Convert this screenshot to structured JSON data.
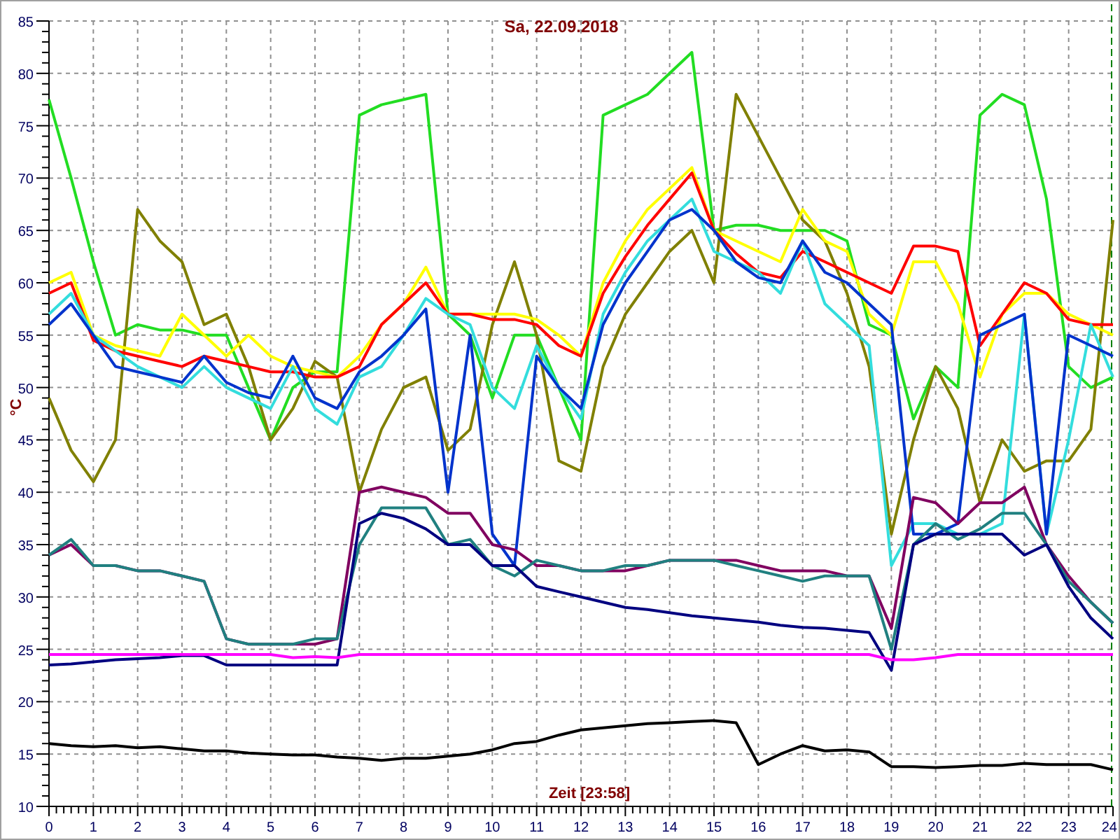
{
  "chart": {
    "chart_data": {
      "type": "line",
      "title": "Sa, 22.09.2018",
      "xlabel": "Zeit [23:58]",
      "ylabel": "°C",
      "x": [
        0,
        0.5,
        1,
        1.5,
        2,
        2.5,
        3,
        3.5,
        4,
        4.5,
        5,
        5.5,
        6,
        6.5,
        7,
        7.5,
        8,
        8.5,
        9,
        9.5,
        10,
        10.5,
        11,
        11.5,
        12,
        12.5,
        13,
        13.5,
        14,
        14.5,
        15,
        15.5,
        16,
        16.5,
        17,
        17.5,
        18,
        18.5,
        19,
        19.5,
        20,
        20.5,
        21,
        21.5,
        22,
        22.5,
        23,
        23.5,
        24
      ],
      "series": [
        {
          "color": "#22dd22",
          "values": [
            77.5,
            70,
            62,
            55,
            56,
            55.5,
            55.5,
            55,
            55,
            50,
            45,
            50,
            51.5,
            51.5,
            76,
            77,
            77.5,
            78,
            57,
            55,
            49,
            55,
            55,
            50,
            45,
            76,
            77,
            78,
            80,
            82,
            65,
            65.5,
            65.5,
            65,
            65,
            65,
            64,
            56,
            55,
            47,
            52,
            50,
            76,
            78,
            77,
            68,
            52,
            50,
            51
          ]
        },
        {
          "color": "#808000",
          "values": [
            49,
            44,
            41,
            45,
            67,
            64,
            62,
            56,
            57,
            52,
            45,
            48,
            52.5,
            51,
            40,
            46,
            50,
            51,
            44,
            46,
            56,
            62,
            55,
            43,
            42,
            52,
            57,
            60,
            63,
            65,
            60,
            78,
            74,
            70,
            66,
            64,
            59,
            52,
            36,
            45,
            52,
            48,
            39,
            45,
            42,
            43,
            43,
            46,
            66
          ]
        },
        {
          "color": "#ffff00",
          "values": [
            60,
            61,
            55,
            54,
            53.5,
            53,
            57,
            55,
            53,
            55,
            53,
            52,
            51.5,
            51,
            53,
            56,
            58,
            61.5,
            57,
            57,
            57,
            57,
            56.5,
            55,
            53,
            60,
            64,
            67,
            69,
            71,
            65,
            64,
            63,
            62,
            67,
            64,
            63,
            57,
            55,
            62,
            62,
            58,
            51,
            57,
            59,
            59,
            57,
            56,
            55
          ]
        },
        {
          "color": "#ff0000",
          "values": [
            59,
            60,
            54.5,
            53.5,
            53,
            52.5,
            52,
            53,
            52.5,
            52,
            51.5,
            51.5,
            51,
            51,
            52,
            56,
            58,
            60,
            57,
            57,
            56.5,
            56.5,
            56,
            54,
            53,
            59,
            62.5,
            65.5,
            68,
            70.5,
            65,
            62.8,
            61,
            60.5,
            63,
            62,
            61,
            60,
            59,
            63.5,
            63.5,
            63,
            54,
            57,
            60,
            59,
            56.5,
            56,
            56
          ]
        },
        {
          "color": "#33dddd",
          "values": [
            57,
            59,
            55,
            53.5,
            52,
            51,
            50,
            52,
            50,
            49,
            48,
            52,
            48,
            46.5,
            51,
            52,
            55,
            58.5,
            57,
            56,
            50,
            48,
            54,
            50,
            47,
            57,
            61,
            64,
            66,
            68,
            63,
            62,
            61,
            59,
            64,
            58,
            56,
            54,
            33,
            37,
            37,
            36,
            36,
            37,
            57,
            36,
            45,
            56,
            51
          ]
        },
        {
          "color": "#0033cc",
          "values": [
            56,
            58,
            55,
            52,
            51.5,
            51,
            50.5,
            53,
            50.5,
            49.5,
            49,
            53,
            49,
            48,
            51.5,
            53,
            55,
            57.5,
            40,
            55,
            36,
            33,
            53,
            50,
            48,
            56,
            60,
            63,
            66,
            67,
            65,
            62,
            60.5,
            60,
            64,
            61,
            60,
            58,
            56,
            36,
            36,
            37,
            55,
            56,
            57,
            36,
            55,
            54,
            53
          ]
        },
        {
          "color": "#800060",
          "values": [
            34,
            35,
            33,
            33,
            32.5,
            32.5,
            32,
            31.5,
            26,
            25.5,
            25.5,
            25.5,
            25.5,
            26,
            40,
            40.5,
            40,
            39.5,
            38,
            38,
            35,
            34.5,
            33,
            33,
            32.5,
            32.5,
            32.5,
            33,
            33.5,
            33.5,
            33.5,
            33.5,
            33,
            32.5,
            32.5,
            32.5,
            32,
            32,
            27,
            39.5,
            39,
            37,
            39,
            39,
            40.5,
            35,
            32,
            29.5,
            27.5
          ]
        },
        {
          "color": "#208080",
          "values": [
            34,
            35.5,
            33,
            33,
            32.5,
            32.5,
            32,
            31.5,
            26,
            25.5,
            25.5,
            25.5,
            26,
            26,
            35,
            38.5,
            38.5,
            38.5,
            35,
            35.5,
            33,
            32,
            33.5,
            33,
            32.5,
            32.5,
            33,
            33,
            33.5,
            33.5,
            33.5,
            33,
            32.5,
            32,
            31.5,
            32,
            32,
            32,
            25,
            35,
            37,
            35.5,
            36.5,
            38,
            38,
            35,
            31.5,
            29.5,
            27.5
          ]
        },
        {
          "color": "#000080",
          "values": [
            23.5,
            23.6,
            23.8,
            24,
            24.1,
            24.2,
            24.4,
            24.4,
            23.5,
            23.5,
            23.5,
            23.5,
            23.5,
            23.5,
            37,
            38,
            37.5,
            36.5,
            35,
            35,
            33,
            33,
            31,
            30.5,
            30,
            29.5,
            29,
            28.8,
            28.5,
            28.2,
            28,
            27.8,
            27.6,
            27.3,
            27.1,
            27,
            26.8,
            26.6,
            23,
            35,
            36,
            36,
            36,
            36,
            34,
            35,
            31,
            28,
            26
          ]
        },
        {
          "color": "#ff00ff",
          "values": [
            24.5,
            24.5,
            24.5,
            24.5,
            24.5,
            24.5,
            24.5,
            24.5,
            24.5,
            24.5,
            24.5,
            24.2,
            24.3,
            24.2,
            24.5,
            24.5,
            24.5,
            24.5,
            24.5,
            24.5,
            24.5,
            24.5,
            24.5,
            24.5,
            24.5,
            24.5,
            24.5,
            24.5,
            24.5,
            24.5,
            24.5,
            24.5,
            24.5,
            24.5,
            24.5,
            24.5,
            24.5,
            24.5,
            24,
            24,
            24.2,
            24.5,
            24.5,
            24.5,
            24.5,
            24.5,
            24.5,
            24.5,
            24.5
          ]
        },
        {
          "color": "#000000",
          "values": [
            16,
            15.8,
            15.7,
            15.8,
            15.6,
            15.7,
            15.5,
            15.3,
            15.3,
            15.1,
            15,
            14.9,
            14.9,
            14.7,
            14.6,
            14.4,
            14.6,
            14.6,
            14.8,
            15,
            15.4,
            16,
            16.2,
            16.8,
            17.3,
            17.5,
            17.7,
            17.9,
            18,
            18.1,
            18.2,
            18,
            14,
            15,
            15.8,
            15.3,
            15.4,
            15.2,
            13.8,
            13.8,
            13.7,
            13.8,
            13.9,
            13.9,
            14.1,
            14,
            14,
            14,
            13.5
          ]
        }
      ],
      "xlim": [
        0,
        24
      ],
      "ylim": [
        10,
        85
      ],
      "xticks": [
        0,
        1,
        2,
        3,
        4,
        5,
        6,
        7,
        8,
        9,
        10,
        11,
        12,
        13,
        14,
        15,
        16,
        17,
        18,
        19,
        20,
        21,
        22,
        23,
        24
      ],
      "yticks": [
        10,
        15,
        20,
        25,
        30,
        35,
        40,
        45,
        50,
        55,
        60,
        65,
        70,
        75,
        80,
        85
      ],
      "grid": true
    }
  }
}
